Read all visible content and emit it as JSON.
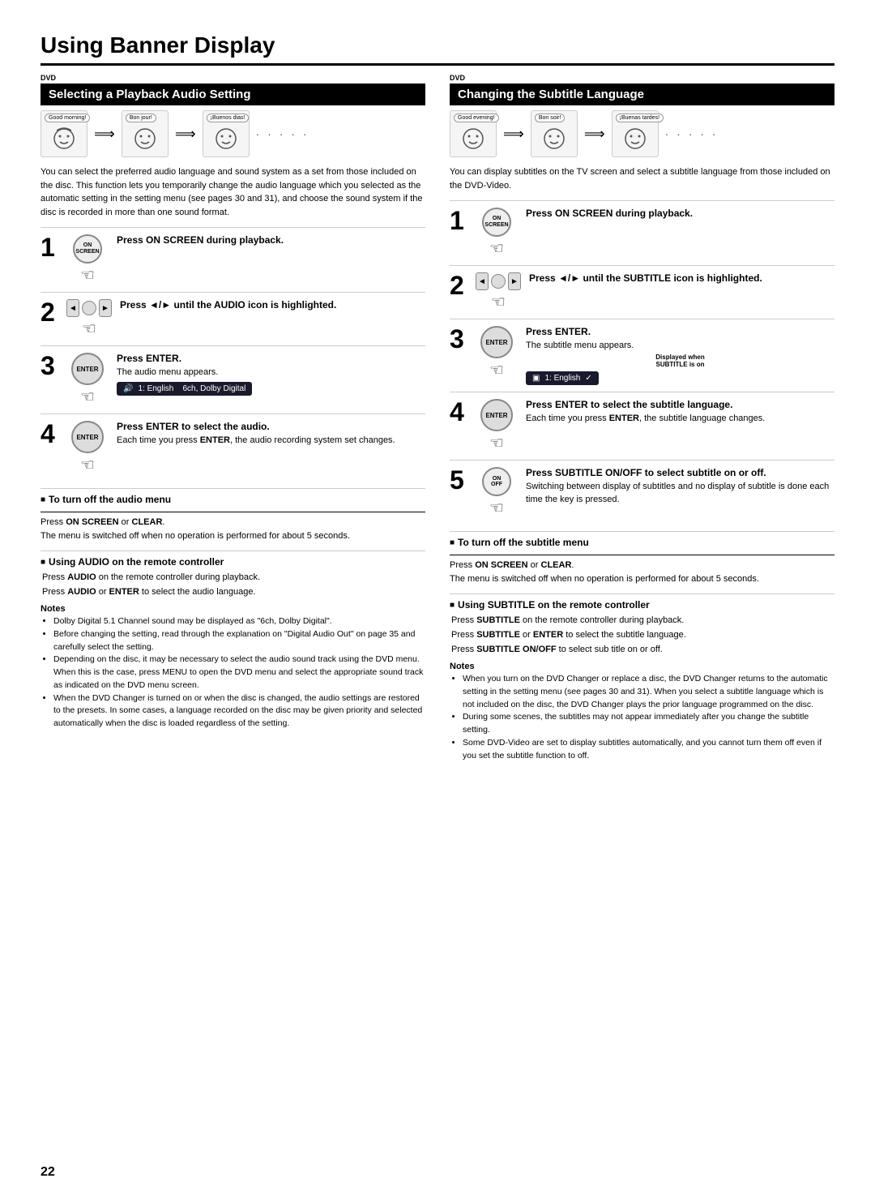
{
  "page": {
    "title": "Using Banner Display",
    "page_number": "22"
  },
  "left_section": {
    "dvd_label": "DVD",
    "header": "Selecting a Playback Audio Setting",
    "illustrations": [
      {
        "bubble": "Good morning!"
      },
      {
        "bubble": "Bon jour!"
      },
      {
        "bubble": "¡Buenos dias!"
      }
    ],
    "body_text": "You can select the preferred audio language and sound system as a set from those included on the disc. This function lets you temporarily change the audio language which you selected as the automatic setting in the setting menu (see pages 30 and 31), and choose the sound system if the disc is recorded in more than one sound format.",
    "steps": [
      {
        "number": "1",
        "icon": "on-screen-btn",
        "title": "Press ON SCREEN during playback.",
        "sub": ""
      },
      {
        "number": "2",
        "icon": "dpad-btn",
        "title": "Press ◄/► until the AUDIO icon is highlighted.",
        "sub": ""
      },
      {
        "number": "3",
        "icon": "enter-btn",
        "title": "Press ENTER.",
        "sub": "The audio menu appears.",
        "menu": "1: English   6ch, Dolby Digital"
      },
      {
        "number": "4",
        "icon": "enter-btn",
        "title": "Press ENTER to select the audio.",
        "sub": "Each time you press ENTER, the audio recording system set changes."
      }
    ],
    "note_turn_off": {
      "title": "To turn off the audio menu",
      "body": "Press ON SCREEN or CLEAR.\nThe menu is switched off when no operation is performed for about 5 seconds."
    },
    "note_remote": {
      "title": "Using AUDIO on the remote controller",
      "items": [
        "Press AUDIO on the remote controller during playback.",
        "Press AUDIO or ENTER to select the audio language."
      ]
    },
    "notes": {
      "title": "Notes",
      "items": [
        "Dolby Digital 5.1 Channel sound may be displayed as \"6ch, Dolby Digital\".",
        "Before changing the setting, read through the explanation on \"Digital Audio Out\" on page 35 and carefully select the setting.",
        "Depending on the disc, it may be necessary to select the audio sound track using the DVD menu. When this is the case, press MENU to open the DVD menu and select the appropriate sound track as indicated on the DVD menu screen.",
        "When the DVD Changer is turned on or when the disc is changed, the audio settings are restored to the presets. In some cases, a language recorded on the disc may be given priority and selected automatically when the disc is loaded regardless of the setting."
      ]
    }
  },
  "right_section": {
    "dvd_label": "DVD",
    "header": "Changing the Subtitle Language",
    "illustrations": [
      {
        "bubble": "Good evening!"
      },
      {
        "bubble": "Bon soir!"
      },
      {
        "bubble": "¡Buenas tardes!"
      }
    ],
    "body_text": "You can display subtitles on the TV screen and select a subtitle language from those included on the DVD-Video.",
    "steps": [
      {
        "number": "1",
        "icon": "on-screen-btn",
        "title": "Press ON SCREEN during playback.",
        "sub": ""
      },
      {
        "number": "2",
        "icon": "dpad-btn",
        "title": "Press ◄/► until the SUBTITLE icon is highlighted.",
        "sub": ""
      },
      {
        "number": "3",
        "icon": "enter-btn",
        "title": "Press ENTER.",
        "sub": "The subtitle menu appears.",
        "menu_label": "Displayed when\nSUBTITLE is on",
        "menu": "1: English"
      },
      {
        "number": "4",
        "icon": "enter-btn",
        "title": "Press ENTER to select the subtitle language.",
        "sub": "Each time you press ENTER, the subtitle language changes."
      },
      {
        "number": "5",
        "icon": "onoff-btn",
        "title": "Press SUBTITLE ON/OFF to select subtitle on or off.",
        "sub": "Switching between display of subtitles and no display of subtitle is done each time the key is pressed."
      }
    ],
    "note_turn_off": {
      "title": "To turn off the subtitle menu",
      "body": "Press ON SCREEN or CLEAR.\nThe menu is switched off when no operation is performed for about 5 seconds."
    },
    "note_remote": {
      "title": "Using SUBTITLE on the remote controller",
      "items": [
        "Press SUBTITLE on the remote controller during playback.",
        "Press SUBTITLE or ENTER to select the subtitle language.",
        "Press SUBTITLE ON/OFF to select sub title on or off."
      ]
    },
    "notes": {
      "title": "Notes",
      "items": [
        "When you turn on the DVD Changer or replace a disc, the DVD Changer returns to the automatic setting in the setting menu (see pages 30 and 31). When you select a subtitle language which is not included on the disc, the DVD Changer plays the prior language programmed on the disc.",
        "During some scenes, the subtitles may not appear immediately after you change the subtitle setting.",
        "Some DVD-Video are set to display subtitles automatically, and you cannot turn them off even if you set the subtitle function to off."
      ]
    }
  }
}
